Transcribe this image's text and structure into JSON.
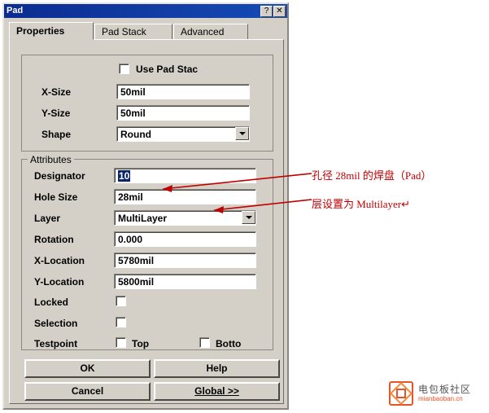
{
  "window": {
    "title": "Pad",
    "help_button": "?",
    "close_button": "✕"
  },
  "tabs": [
    {
      "label": "Properties",
      "active": true
    },
    {
      "label": "Pad Stack",
      "active": false
    },
    {
      "label": "Advanced",
      "active": false
    }
  ],
  "properties": {
    "use_pad_stack_label": "Use Pad Stac",
    "use_pad_stack_checked": false,
    "fields": [
      {
        "label": "X-Size",
        "value": "50mil",
        "type": "text"
      },
      {
        "label": "Y-Size",
        "value": "50mil",
        "type": "text"
      },
      {
        "label": "Shape",
        "value": "Round",
        "type": "combo"
      }
    ]
  },
  "attributes": {
    "group_label": "Attributes",
    "rows": [
      {
        "label": "Designator",
        "value": "10",
        "type": "text",
        "selected": true
      },
      {
        "label": "Hole Size",
        "value": "28mil",
        "type": "text"
      },
      {
        "label": "Layer",
        "value": "MultiLayer",
        "type": "combo"
      },
      {
        "label": "Rotation",
        "value": "0.000",
        "type": "text"
      },
      {
        "label": "X-Location",
        "value": "5780mil",
        "type": "text"
      },
      {
        "label": "Y-Location",
        "value": "5800mil",
        "type": "text"
      }
    ],
    "locked": {
      "label": "Locked",
      "checked": false
    },
    "selection": {
      "label": "Selection",
      "checked": false
    },
    "testpoint": {
      "label": "Testpoint",
      "top_label": "Top",
      "top_checked": false,
      "bottom_label": "Botto",
      "bottom_checked": false
    }
  },
  "buttons": {
    "ok": "OK",
    "help": "Help",
    "cancel": "Cancel",
    "global": "Global >>"
  },
  "annotations": [
    {
      "text": "孔径 28mil 的焊盘（Pad）"
    },
    {
      "text": "层设置为 Multilayer↵"
    }
  ],
  "watermark": {
    "line1": "电包板社区",
    "line2": "mianbaoban.cn"
  },
  "colors": {
    "dialog_face": "#d4d0c8",
    "titlebar": "#0a2a8c",
    "annotation": "#c00000",
    "selection": "#0a246a",
    "watermark_accent": "#e8532a"
  }
}
